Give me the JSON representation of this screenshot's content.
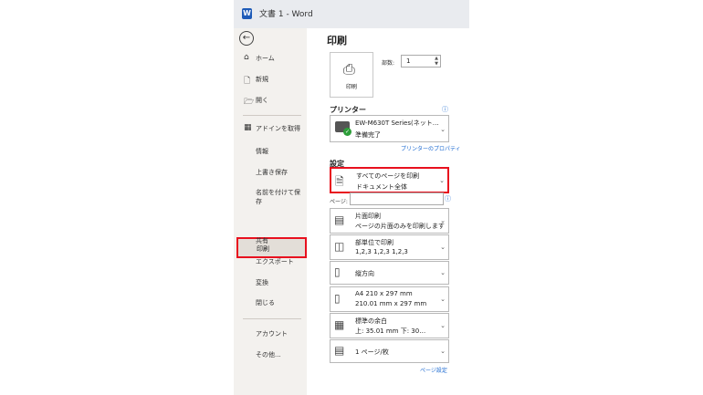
{
  "window": {
    "title": "文書 1  -  Word",
    "logo_letter": "W"
  },
  "sidebar": {
    "back": "←",
    "items": [
      {
        "key": "home",
        "icon": "⌂",
        "label": "ホーム"
      },
      {
        "key": "new",
        "icon": "🗋",
        "label": "新規"
      },
      {
        "key": "open",
        "icon": "🗁",
        "label": "開く"
      },
      {
        "key": "addins",
        "icon": "▦",
        "label": "アドインを取得"
      }
    ],
    "sub_items": [
      {
        "label": "情報"
      },
      {
        "label": "上書き保存"
      },
      {
        "label": "名前を付けて保存"
      },
      {
        "label": "印刷"
      },
      {
        "label": "共有"
      },
      {
        "label": "エクスポート"
      },
      {
        "label": "変換"
      },
      {
        "label": "閉じる"
      },
      {
        "label": "アカウント"
      },
      {
        "label": "その他..."
      }
    ]
  },
  "main": {
    "title": "印刷",
    "print_button": "印刷",
    "copies_label": "部数:",
    "copies_value": "1",
    "printer_heading": "プリンター",
    "printer_name": "EW-M630T Series(ネット…",
    "printer_status": "準備完了",
    "printer_props": "プリンターのプロパティ",
    "settings_heading": "設定",
    "print_range_1": "すべてのページを印刷",
    "print_range_2": "ドキュメント全体",
    "pages_label": "ページ:",
    "pages_value": "",
    "sides_1": "片面印刷",
    "sides_2": "ページの片面のみを印刷します",
    "collate_1": "部単位で印刷",
    "collate_2": "1,2,3    1,2,3    1,2,3",
    "orientation_1": "縦方向",
    "paper_1": "A4 210 x 297 mm",
    "paper_2": "210.01 mm x 297 mm",
    "margins_1": "標準の余白",
    "margins_2": "上: 35.01 mm 下: 30…",
    "pps_1": "1 ページ/枚",
    "page_setup_link": "ページ設定"
  },
  "colors": {
    "highlight": "#e8101e",
    "link": "#1e6bd1",
    "titlebar": "#e9ebef",
    "sidebar": "#f3f1ee"
  }
}
